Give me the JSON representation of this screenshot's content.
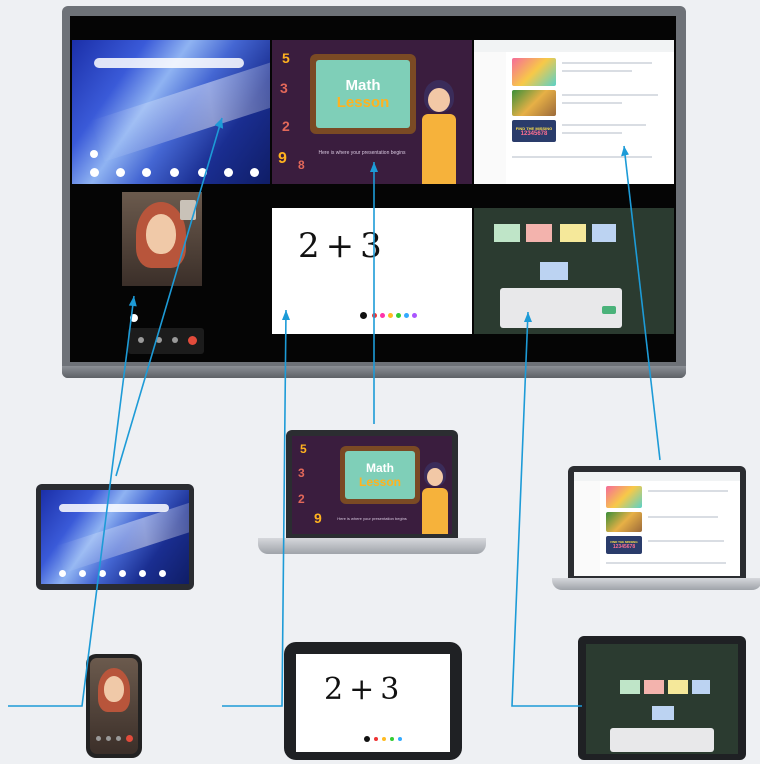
{
  "math_lesson": {
    "title_line1": "Math",
    "title_line2": "Lesson",
    "subtitle": "Here is where your presentation begins"
  },
  "whiteboard": {
    "expression": "2+3"
  },
  "browser": {
    "banner_text": "FIND THE MISSING",
    "number_strip": "12345678"
  },
  "decor_numbers": [
    "5",
    "3",
    "2",
    "9",
    "8"
  ],
  "colors": {
    "connector": "#1d9bd7",
    "slide_bg": "#3a1d3e",
    "board_frame": "#7a4a24",
    "board_face": "#7fcfb8",
    "accent_orange": "#ffb21f",
    "greenboard": "#2b3b30"
  },
  "icons": [
    "home-icon",
    "camera-icon",
    "end-call-icon",
    "pen-icon"
  ]
}
